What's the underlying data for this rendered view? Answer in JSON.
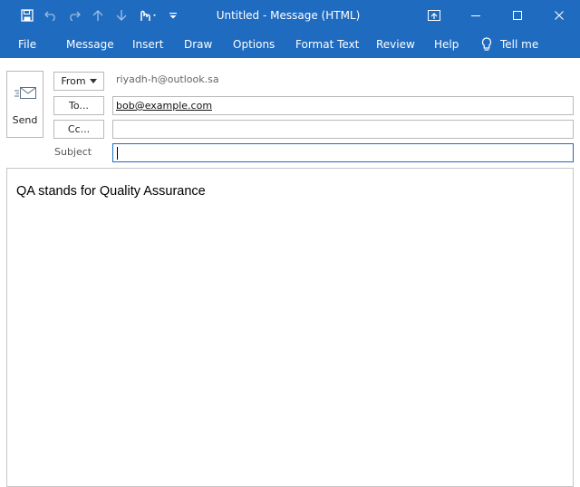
{
  "window": {
    "title": "Untitled  -  Message (HTML)"
  },
  "quick_access": {
    "save": "save-icon",
    "undo": "undo-icon",
    "redo": "redo-icon",
    "up": "arrow-up-icon",
    "down": "arrow-down-icon",
    "touch": "touch-mode-icon",
    "customize": "customize-toolbar-icon"
  },
  "ribbon": {
    "tabs": [
      "File",
      "Message",
      "Insert",
      "Draw",
      "Options",
      "Format Text",
      "Review",
      "Help"
    ],
    "tell_me": "Tell me"
  },
  "compose": {
    "send_label": "Send",
    "from_label": "From",
    "from_address": "riyadh-h@outlook.sa",
    "to_label": "To...",
    "to_value": "bob@example.com",
    "cc_label": "Cc...",
    "cc_value": "",
    "subject_label": "Subject",
    "subject_value": "",
    "body_text": "QA stands for Quality Assurance"
  },
  "colors": {
    "accent": "#1f6bc0",
    "border": "#b9b9b9"
  }
}
